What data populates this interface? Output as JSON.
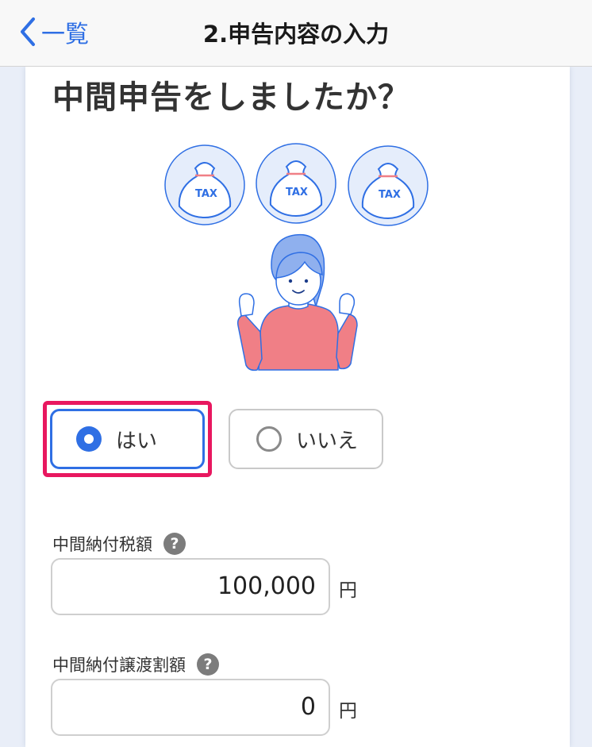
{
  "nav": {
    "back_label": "一覧",
    "title": "2.申告内容の入力"
  },
  "page": {
    "heading": "中間申告をしましたか？"
  },
  "illustration": {
    "bag_text": "TAX",
    "icons": [
      "tax-bag-icon",
      "person-cheering-icon"
    ]
  },
  "options": {
    "yes_label": "はい",
    "no_label": "いいえ",
    "selected": "はい"
  },
  "fields": {
    "interim_tax": {
      "label": "中間納付税額",
      "value": "100,000",
      "unit": "円"
    },
    "interim_transfer": {
      "label": "中間納付譲渡割額",
      "value": "0",
      "unit": "円"
    },
    "help_glyph": "?"
  },
  "colors": {
    "accent": "#2f6fe4",
    "highlight": "#e8175f",
    "shirt": "#f07f86"
  }
}
